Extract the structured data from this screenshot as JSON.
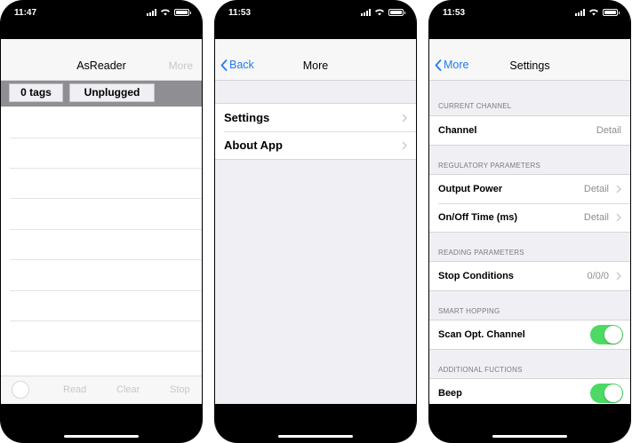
{
  "screens": [
    {
      "time": "11:47",
      "title": "AsReader",
      "right_button": "More",
      "tag_count": "0 tags",
      "connection_status": "Unplugged",
      "toolbar": {
        "read": "Read",
        "clear": "Clear",
        "stop": "Stop"
      }
    },
    {
      "time": "11:53",
      "back_label": "Back",
      "title": "More",
      "items": [
        {
          "label": "Settings"
        },
        {
          "label": "About App"
        }
      ]
    },
    {
      "time": "11:53",
      "back_label": "More",
      "title": "Settings",
      "sections": [
        {
          "header": "CURRENT CHANNEL",
          "rows": [
            {
              "label": "Channel",
              "detail": "Detail"
            }
          ]
        },
        {
          "header": "REGULATORY PARAMETERS",
          "rows": [
            {
              "label": "Output Power",
              "detail": "Detail"
            },
            {
              "label": "On/Off Time (ms)",
              "detail": "Detail"
            }
          ]
        },
        {
          "header": "READING PARAMETERS",
          "rows": [
            {
              "label": "Stop Conditions",
              "detail": "0/0/0"
            }
          ]
        },
        {
          "header": "SMART HOPPING",
          "rows": [
            {
              "label": "Scan Opt. Channel",
              "toggle": true
            }
          ]
        },
        {
          "header": "ADDITIONAL FUCTIONS",
          "rows": [
            {
              "label": "Beep",
              "toggle": true
            }
          ]
        }
      ]
    }
  ],
  "colors": {
    "accent_blue": "#1f7cf2",
    "toggle_on": "#4cd964",
    "grouped_background": "#efeff4",
    "disabled_text": "#c8c8cc"
  },
  "icons": [
    "back-chevron-icon",
    "disclosure-chevron-icon",
    "signal-icon",
    "wifi-icon",
    "battery-icon"
  ]
}
